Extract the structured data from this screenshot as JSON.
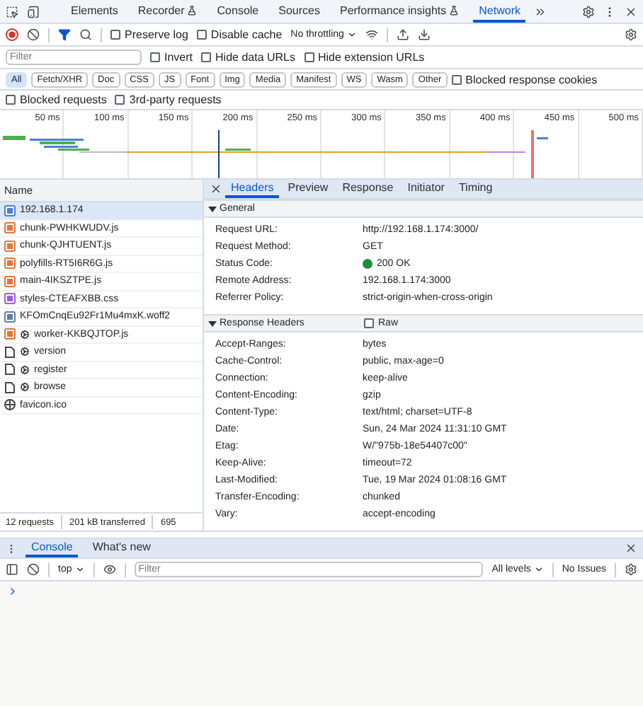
{
  "top_tabs": [
    {
      "label": "Elements",
      "selected": false,
      "experimental": false
    },
    {
      "label": "Recorder",
      "selected": false,
      "experimental": true
    },
    {
      "label": "Console",
      "selected": false,
      "experimental": false
    },
    {
      "label": "Sources",
      "selected": false,
      "experimental": false
    },
    {
      "label": "Performance insights",
      "selected": false,
      "experimental": true
    },
    {
      "label": "Network",
      "selected": true,
      "experimental": false
    }
  ],
  "toolbar": {
    "options": [
      {
        "label": "Preserve log",
        "checked": false
      },
      {
        "label": "Disable cache",
        "checked": false
      }
    ],
    "throttling": "No throttling"
  },
  "filter": {
    "placeholder": "Filter",
    "options": [
      {
        "label": "Invert",
        "checked": false
      },
      {
        "label": "Hide data URLs",
        "checked": false
      },
      {
        "label": "Hide extension URLs",
        "checked": false
      }
    ]
  },
  "type_filters": [
    {
      "label": "All",
      "selected": true
    },
    {
      "label": "Fetch/XHR",
      "selected": false
    },
    {
      "label": "Doc",
      "selected": false
    },
    {
      "label": "CSS",
      "selected": false
    },
    {
      "label": "JS",
      "selected": false
    },
    {
      "label": "Font",
      "selected": false
    },
    {
      "label": "Img",
      "selected": false
    },
    {
      "label": "Media",
      "selected": false
    },
    {
      "label": "Manifest",
      "selected": false
    },
    {
      "label": "WS",
      "selected": false
    },
    {
      "label": "Wasm",
      "selected": false
    },
    {
      "label": "Other",
      "selected": false
    }
  ],
  "blocked_cookies": {
    "label": "Blocked response cookies",
    "checked": false
  },
  "extra_options": [
    {
      "label": "Blocked requests",
      "checked": false
    },
    {
      "label": "3rd-party requests",
      "checked": false
    }
  ],
  "timeline": {
    "ticks": [
      "50 ms",
      "100 ms",
      "150 ms",
      "200 ms",
      "250 ms",
      "300 ms",
      "350 ms",
      "400 ms",
      "450 ms",
      "500 ms"
    ]
  },
  "requests_header": "Name",
  "requests": [
    {
      "name": "192.168.1.174",
      "kind": "document",
      "service_worker": false,
      "selected": true
    },
    {
      "name": "chunk-PWHKWUDV.js",
      "kind": "script",
      "service_worker": false,
      "selected": false
    },
    {
      "name": "chunk-QJHTUENT.js",
      "kind": "script",
      "service_worker": false,
      "selected": false
    },
    {
      "name": "polyfills-RT5I6R6G.js",
      "kind": "script",
      "service_worker": false,
      "selected": false
    },
    {
      "name": "main-4IKSZTPE.js",
      "kind": "script",
      "service_worker": false,
      "selected": false
    },
    {
      "name": "styles-CTEAFXBB.css",
      "kind": "stylesheet",
      "service_worker": false,
      "selected": false
    },
    {
      "name": "KFOmCnqEu92Fr1Mu4mxK.woff2",
      "kind": "font",
      "service_worker": false,
      "selected": false
    },
    {
      "name": "worker-KKBQJTOP.js",
      "kind": "script",
      "service_worker": true,
      "selected": false
    },
    {
      "name": "version",
      "kind": "fetch",
      "service_worker": true,
      "selected": false
    },
    {
      "name": "register",
      "kind": "fetch",
      "service_worker": true,
      "selected": false
    },
    {
      "name": "browse",
      "kind": "fetch",
      "service_worker": true,
      "selected": false
    },
    {
      "name": "favicon.ico",
      "kind": "other",
      "service_worker": false,
      "selected": false
    }
  ],
  "status_bar": [
    "12 requests",
    "201 kB transferred",
    "695"
  ],
  "details": {
    "tabs": [
      {
        "label": "Headers",
        "selected": true
      },
      {
        "label": "Preview",
        "selected": false
      },
      {
        "label": "Response",
        "selected": false
      },
      {
        "label": "Initiator",
        "selected": false
      },
      {
        "label": "Timing",
        "selected": false
      }
    ],
    "sections": [
      {
        "title": "General",
        "expanded": true,
        "rows": [
          {
            "name": "Request URL:",
            "value": "http://192.168.1.174:3000/"
          },
          {
            "name": "Request Method:",
            "value": "GET"
          },
          {
            "name": "Status Code:",
            "value": "200 OK",
            "color": "#1e8e3e"
          },
          {
            "name": "Remote Address:",
            "value": "192.168.1.174:3000"
          },
          {
            "name": "Referrer Policy:",
            "value": "strict-origin-when-cross-origin"
          }
        ]
      },
      {
        "title": "Response Headers",
        "expanded": true,
        "raw": {
          "label": "Raw",
          "checked": false
        },
        "rows": [
          {
            "name": "Accept-Ranges:",
            "value": "bytes"
          },
          {
            "name": "Cache-Control:",
            "value": "public, max-age=0"
          },
          {
            "name": "Connection:",
            "value": "keep-alive"
          },
          {
            "name": "Content-Encoding:",
            "value": "gzip"
          },
          {
            "name": "Content-Type:",
            "value": "text/html; charset=UTF-8"
          },
          {
            "name": "Date:",
            "value": "Sun, 24 Mar 2024 11:31:10 GMT"
          },
          {
            "name": "Etag:",
            "value": "W/\"975b-18e54407c00\""
          },
          {
            "name": "Keep-Alive:",
            "value": "timeout=72"
          },
          {
            "name": "Last-Modified:",
            "value": "Tue, 19 Mar 2024 01:08:16 GMT"
          },
          {
            "name": "Transfer-Encoding:",
            "value": "chunked"
          },
          {
            "name": "Vary:",
            "value": "accept-encoding"
          }
        ]
      }
    ]
  },
  "drawer": {
    "tabs": [
      {
        "label": "Console",
        "selected": true
      },
      {
        "label": "What's new",
        "selected": false
      }
    ],
    "context": "top",
    "filter_placeholder": "Filter",
    "levels": "All levels",
    "issues": "No Issues"
  }
}
